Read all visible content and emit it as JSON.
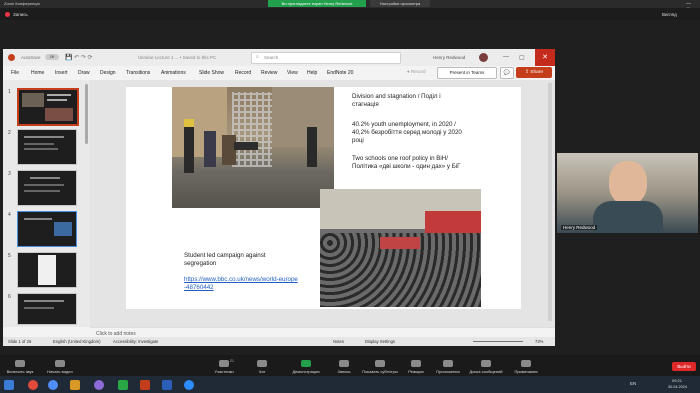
{
  "zoom": {
    "window_title": "Zoom Конференція",
    "share_pill": "Ви проглядаєте екран Henry Redwood",
    "settings_tab": "Настройки просмотра",
    "record_label": "Запись",
    "view_label": "Вигляд",
    "bottom": [
      {
        "label": "Включить звук",
        "icon": "mic-icon"
      },
      {
        "label": "Начать видео",
        "icon": "video-icon"
      },
      {
        "label": "Участники",
        "icon": "participants-icon",
        "count": "21"
      },
      {
        "label": "Чат",
        "icon": "chat-icon"
      },
      {
        "label": "Демонстрация экрана",
        "icon": "share-screen-icon"
      },
      {
        "label": "Запись",
        "icon": "record-icon"
      },
      {
        "label": "Показать субтитры",
        "icon": "captions-icon"
      },
      {
        "label": "Реакции",
        "icon": "reactions-icon"
      },
      {
        "label": "Приложения",
        "icon": "apps-icon"
      },
      {
        "label": "Доска сообщений",
        "icon": "whiteboard-icon"
      },
      {
        "label": "Примечания",
        "icon": "notes-icon"
      }
    ],
    "leave_label": "Выйти"
  },
  "ppt": {
    "autosave": "AutoSave",
    "autosave_state": "Off",
    "doc_title": "Ukraine Lecture 1 ... • Saved to this PC",
    "search_placeholder": "Search",
    "user_name": "Henry Redwood",
    "menu": [
      "File",
      "Home",
      "Insert",
      "Draw",
      "Design",
      "Transitions",
      "Animations",
      "Slide Show",
      "Record",
      "Review",
      "View",
      "Help",
      "EndNote 20"
    ],
    "record_btn": "Record",
    "present_btn": "Present in Teams",
    "share_btn": "Share",
    "thumb_numbers": [
      "1",
      "2",
      "3",
      "4",
      "5",
      "6"
    ],
    "notes_placeholder": "Click to add notes",
    "status": {
      "slide": "Slide 1 of 26",
      "language": "English (United Kingdom)",
      "accessibility": "Accessibility: Investigate",
      "notes": "Notes",
      "display_settings": "Display Settings",
      "zoom": "72%"
    }
  },
  "slide": {
    "text1": "Division and stagnation / Поділ і стагнація",
    "text2": "40.2% youth unemployment, in 2020 / 40,2% безробіття серед молоді у 2020 році",
    "text3": "Two schools one roof policy in BiH/ Політика «дві школи - один дах» у БіГ",
    "caption": "Student led campaign against segregation",
    "link": "https://www.bbc.co.uk/news/world-europe-48760442"
  },
  "video": {
    "participant_name": "Henry Redwood"
  },
  "taskbar": {
    "lang": "EN",
    "time": "09:21",
    "date": "30.04.2024"
  },
  "colors": {
    "ppt_accent": "#c43e1c",
    "zoom_green": "#22a04b",
    "link_blue": "#1f5fbf"
  }
}
